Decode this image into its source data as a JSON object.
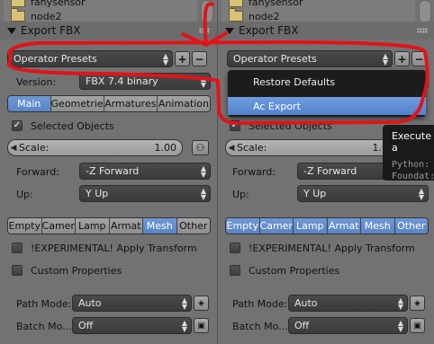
{
  "file_list": {
    "partial_item": "fahysensor",
    "item": "node2"
  },
  "export_panel": {
    "title": "Export FBX",
    "operator_presets": "Operator Presets",
    "add_symbol": "+",
    "remove_symbol": "−",
    "version_label": "Version:",
    "version_value": "FBX 7.4 binary",
    "tabs": [
      "Main",
      "Geometrie",
      "Armatures",
      "Animation"
    ],
    "selected_objects_label": "Selected Objects",
    "scale_label": "Scale:",
    "scale_value": "1.00",
    "forward_label": "Forward:",
    "forward_value": "-Z Forward",
    "up_label": "Up:",
    "up_value": "Y Up",
    "types": [
      "Empty",
      "Camer",
      "Lamp",
      "Armat",
      "Mesh",
      "Other"
    ],
    "experimental_label": "!EXPERIMENTAL! Apply Transform",
    "custom_props_label": "Custom Properties",
    "path_mode_label": "Path Mode:",
    "path_mode_value": "Auto",
    "batch_mode_label": "Batch Mo...",
    "batch_mode_value": "Off"
  },
  "presets_menu": {
    "items": [
      "Restore Defaults",
      "Ac Export"
    ],
    "selected": "Ac Export"
  },
  "tooltip": {
    "title": "Execute a",
    "line1": "Python:",
    "line2": "Foundat:"
  },
  "colors": {
    "accent": "#5a84c4",
    "annotation": "#e0141a"
  }
}
